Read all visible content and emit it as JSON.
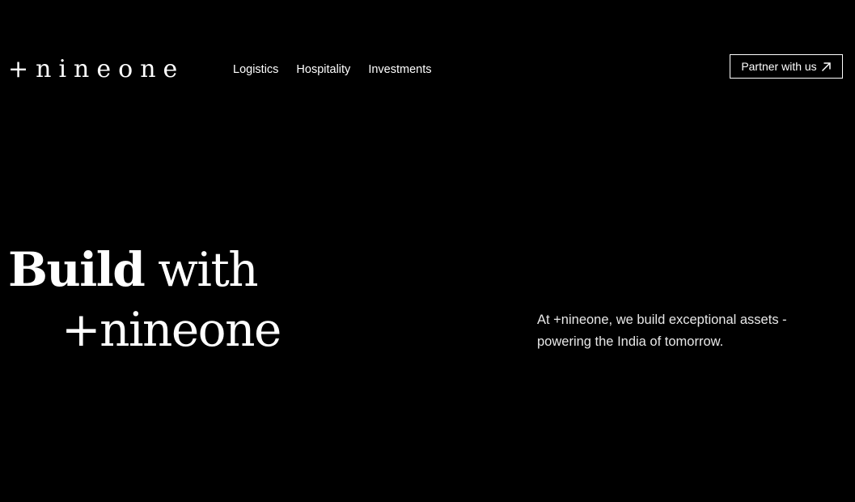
{
  "brand": {
    "logo_text": "+nineone"
  },
  "nav": {
    "items": [
      {
        "label": "Logistics"
      },
      {
        "label": "Hospitality"
      },
      {
        "label": "Investments"
      }
    ]
  },
  "cta": {
    "label": "Partner with us",
    "icon": "arrow-up-right-icon"
  },
  "hero": {
    "title_bold": "Build",
    "title_regular": " with",
    "title_line2": "+nineone",
    "tagline_line1": "At +nineone, we build exceptional assets -",
    "tagline_line2": "powering the India of tomorrow."
  },
  "colors": {
    "background": "#000000",
    "text": "#ffffff"
  }
}
